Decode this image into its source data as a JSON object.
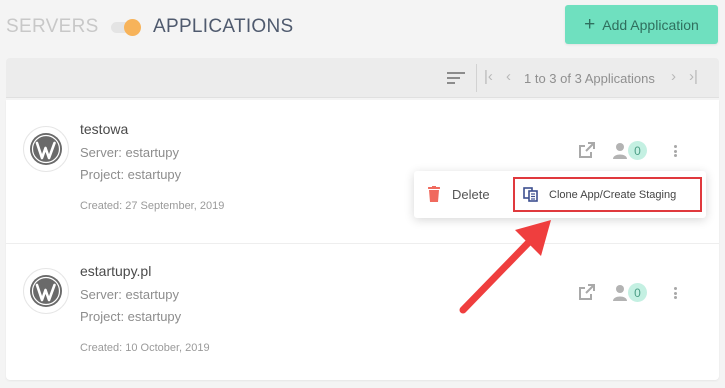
{
  "header": {
    "tab_servers": "SERVERS",
    "tab_applications": "APPLICATIONS",
    "add_button_label": "Add Application"
  },
  "toolbar": {
    "pager_label": "1 to 3 of 3 Applications"
  },
  "apps": [
    {
      "name": "testowa",
      "server": "Server: estartupy",
      "project": "Project: estartupy",
      "created": "Created: 27 September, 2019",
      "user_count": "0"
    },
    {
      "name": "estartupy.pl",
      "server": "Server: estartupy",
      "project": "Project: estartupy",
      "created": "Created: 10 October, 2019",
      "user_count": "0"
    }
  ],
  "menu": {
    "delete_label": "Delete",
    "clone_label": "Clone App/Create Staging"
  },
  "colors": {
    "accent": "#6fe0bf",
    "toggle_knob": "#f7b35a",
    "highlight": "#e0393d",
    "delete_icon": "#f06a5e",
    "clone_icon": "#3d4f8f",
    "badge_bg": "#c4f0e2"
  },
  "icons": {
    "app_logo": "wordpress-icon",
    "sort": "sort-icon",
    "external_link": "external-link-icon",
    "user": "user-icon",
    "more": "kebab-icon",
    "delete": "trash-icon",
    "clone": "clone-icon"
  }
}
